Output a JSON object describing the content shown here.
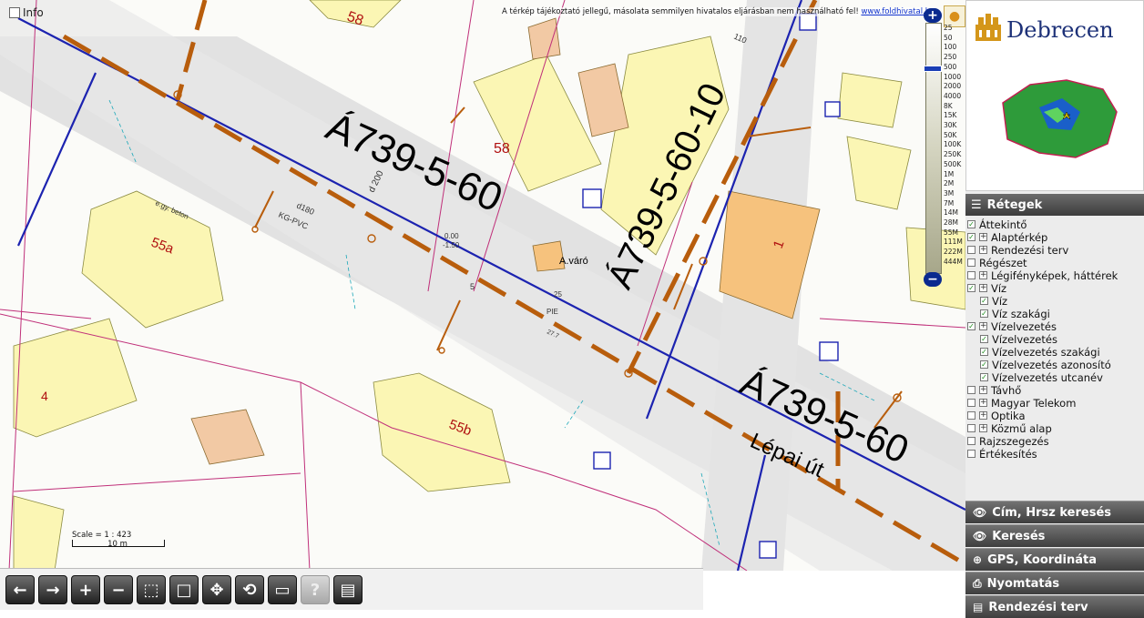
{
  "info": {
    "label": "Info"
  },
  "disclaimer": {
    "text": "A térkép tájékoztató jellegű, másolata semmilyen hivatalos eljárásban nem használható fel!",
    "link": "www.foldhivatal.hu"
  },
  "zoom": {
    "plus": "+",
    "minus": "−",
    "scales": [
      "25",
      "50",
      "100",
      "250",
      "500",
      "1000",
      "2000",
      "4000",
      "8K",
      "15K",
      "30K",
      "50K",
      "100K",
      "250K",
      "500K",
      "1M",
      "2M",
      "3M",
      "7M",
      "14M",
      "28M",
      "55M",
      "111M",
      "222M",
      "444M"
    ]
  },
  "scalebar": {
    "scale": "Scale = 1 : 423",
    "distance": "10 m"
  },
  "map_labels": {
    "segment_main": "Á739-5-60",
    "segment_branch": "Á739-5-60-10",
    "segment_lower": "Á739-5-60",
    "street": "Lépai út",
    "parcel_58a": "58",
    "parcel_58": "58",
    "parcel_55a": "55a",
    "parcel_55b": "55b",
    "parcel_4": "4",
    "parcel_1": "1",
    "a_varo": "A.váró",
    "pipe_d200": "d 200",
    "pipe_kg": "KG-PVC",
    "pipe_d180": "d180",
    "ebeton": "e.gy. beton",
    "depth1": "0.00",
    "depth2": "-1.50",
    "n110": "110",
    "n5": "5",
    "n25": "25",
    "pie": "PIE",
    "n27": "27.7"
  },
  "logo": {
    "city": "Debrecen"
  },
  "layers": {
    "title": "Rétegek",
    "items": [
      {
        "label": "Áttekintő",
        "checked": true,
        "expand": false,
        "indent": 0
      },
      {
        "label": "Alaptérkép",
        "checked": true,
        "expand": true,
        "indent": 0
      },
      {
        "label": "Rendezési terv",
        "checked": false,
        "expand": true,
        "indent": 0
      },
      {
        "label": "Régészet",
        "checked": false,
        "expand": false,
        "indent": 0
      },
      {
        "label": "Légifényképek, háttérek",
        "checked": false,
        "expand": true,
        "indent": 0
      },
      {
        "label": "Víz",
        "checked": true,
        "expand": true,
        "indent": 0
      },
      {
        "label": "Víz",
        "checked": true,
        "expand": false,
        "indent": 1
      },
      {
        "label": "Víz szakági",
        "checked": true,
        "expand": false,
        "indent": 1
      },
      {
        "label": "Vízelvezetés",
        "checked": true,
        "expand": true,
        "indent": 0
      },
      {
        "label": "Vízelvezetés",
        "checked": true,
        "expand": false,
        "indent": 1
      },
      {
        "label": "Vízelvezetés szakági",
        "checked": true,
        "expand": false,
        "indent": 1
      },
      {
        "label": "Vízelvezetés azonosító",
        "checked": true,
        "expand": false,
        "indent": 1
      },
      {
        "label": "Vízelvezetés utcanév",
        "checked": true,
        "expand": false,
        "indent": 1
      },
      {
        "label": "Távhő",
        "checked": false,
        "expand": true,
        "indent": 0
      },
      {
        "label": "Magyar Telekom",
        "checked": false,
        "expand": true,
        "indent": 0
      },
      {
        "label": "Optika",
        "checked": false,
        "expand": true,
        "indent": 0
      },
      {
        "label": "Közmű alap",
        "checked": false,
        "expand": true,
        "indent": 0
      },
      {
        "label": "Rajzszegezés",
        "checked": false,
        "expand": false,
        "indent": 0
      },
      {
        "label": "Értékesítés",
        "checked": false,
        "expand": false,
        "indent": 0
      }
    ]
  },
  "panels": [
    {
      "label": "Cím, Hrsz keresés",
      "icon": "eye-icon"
    },
    {
      "label": "Keresés",
      "icon": "eye-icon"
    },
    {
      "label": "GPS, Koordináta",
      "icon": "crosshair-icon"
    },
    {
      "label": "Nyomtatás",
      "icon": "printer-icon"
    },
    {
      "label": "Rendezési terv",
      "icon": "document-icon"
    }
  ],
  "toolbar": [
    {
      "name": "pan-left-button",
      "icon": "arrow-left-icon",
      "enabled": true
    },
    {
      "name": "pan-right-button",
      "icon": "arrow-right-icon",
      "enabled": true
    },
    {
      "name": "zoom-in-button",
      "icon": "plus-icon",
      "enabled": true
    },
    {
      "name": "zoom-out-button",
      "icon": "minus-icon",
      "enabled": true
    },
    {
      "name": "zoom-box-button",
      "icon": "zoom-box-icon",
      "enabled": true
    },
    {
      "name": "full-extent-button",
      "icon": "extent-icon",
      "enabled": true
    },
    {
      "name": "pan-button",
      "icon": "move-icon",
      "enabled": true
    },
    {
      "name": "refresh-button",
      "icon": "refresh-icon",
      "enabled": true
    },
    {
      "name": "measure-button",
      "icon": "ruler-icon",
      "enabled": true
    },
    {
      "name": "help-button",
      "icon": "question-icon",
      "enabled": false
    },
    {
      "name": "legend-button",
      "icon": "document-icon",
      "enabled": true
    }
  ],
  "colors": {
    "building": "#fbf6b4",
    "pipe_brown": "#b85d0c",
    "pipe_blue": "#1c23b0",
    "parcel_line": "#c0307a",
    "road": "#e2e2e2",
    "accent": "#0a2a8f"
  }
}
